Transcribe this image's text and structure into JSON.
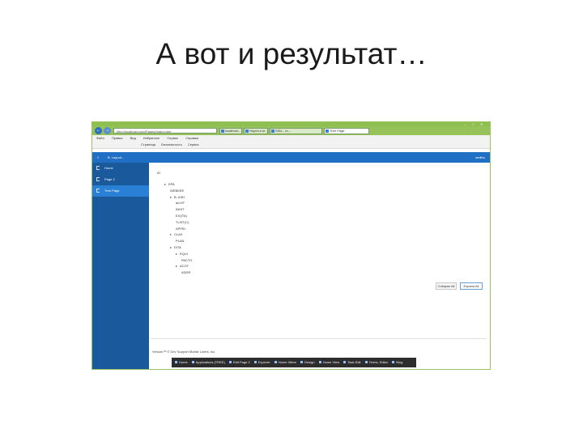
{
  "slide": {
    "title": "А вот и результат…"
  },
  "browser": {
    "address": "http://localhost:xxxx/Pages/Index.html",
    "tabs": [
      {
        "label": "localhost..."
      },
      {
        "label": "Hopes.e-ie..."
      },
      {
        "label": "SIDL.. m..."
      },
      {
        "label": "Tree Page"
      }
    ],
    "window_controls": {
      "minimize": "–",
      "maximize": "□",
      "close": "✕"
    },
    "menu": [
      "Файл",
      "Правка",
      "Вид",
      "Избранное",
      "Сервис",
      "Справка"
    ],
    "fav_bar": {
      "items": [
        "Страница",
        "Безопасность",
        "Сервис"
      ]
    }
  },
  "app": {
    "header_title": "B. Layout...",
    "header_right": "sedfbo"
  },
  "sidebar": {
    "items": [
      {
        "label": "Home",
        "active": false
      },
      {
        "label": "Page 2",
        "active": false
      },
      {
        "label": "Tree Page",
        "active": true
      }
    ]
  },
  "tree": {
    "rows": [
      {
        "text": "ID",
        "indent": 0,
        "toggle": ""
      },
      {
        "text": "EPA",
        "indent": 1,
        "toggle": "▸"
      },
      {
        "text": "WEBKEE",
        "indent": 2,
        "toggle": ""
      },
      {
        "text": "B..ASH",
        "indent": 2,
        "toggle": "▸"
      },
      {
        "text": "ad-HT",
        "indent": 3,
        "toggle": ""
      },
      {
        "text": "INHIT",
        "indent": 3,
        "toggle": ""
      },
      {
        "text": "EX(ITA)",
        "indent": 3,
        "toggle": ""
      },
      {
        "text": "TLIST(C)",
        "indent": 3,
        "toggle": ""
      },
      {
        "text": "APPID",
        "indent": 3,
        "toggle": ""
      },
      {
        "text": "CLAX",
        "indent": 2,
        "toggle": "▸"
      },
      {
        "text": "PLAN",
        "indent": 3,
        "toggle": ""
      },
      {
        "text": "DITA",
        "indent": 2,
        "toggle": "▸"
      },
      {
        "text": "EQUI",
        "indent": 3,
        "toggle": "▸"
      },
      {
        "text": "PACTO",
        "indent": 4,
        "toggle": ""
      },
      {
        "text": "ACOT",
        "indent": 3,
        "toggle": "▸"
      },
      {
        "text": "ADDR",
        "indent": 4,
        "toggle": ""
      }
    ]
  },
  "buttons": {
    "collapse": "Collapse All",
    "expand": "Expand All"
  },
  "footer": {
    "text": "Version™ © Dev Support Mobile Liners, Inc."
  },
  "taskbar": {
    "items": [
      "Home",
      "Applications (TREE)",
      "Edit Page 2",
      "Explorer",
      "Home Hitem",
      "Design",
      "Home View",
      "Task Edit",
      "Terms, Editor",
      "Blog"
    ]
  },
  "colors": {
    "chrome_green": "#8fbf50",
    "app_blue": "#1f6fc4",
    "sidebar_blue": "#1a5a9c",
    "sidebar_active": "#2a80d4",
    "taskbar": "#2d2d2d"
  }
}
